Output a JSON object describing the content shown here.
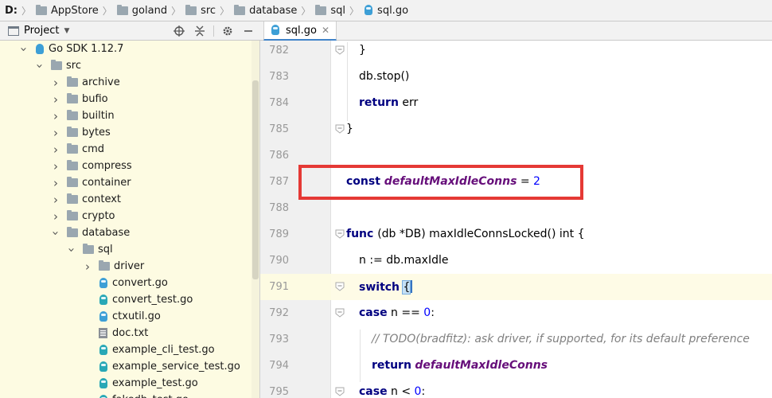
{
  "breadcrumb": {
    "drive": "D:",
    "items": [
      "AppStore",
      "goland",
      "src",
      "database",
      "sql",
      "sql.go"
    ]
  },
  "project_panel": {
    "title": "Project",
    "tools": [
      "locate-icon",
      "collapse-icon",
      "gear-icon",
      "hide-icon"
    ]
  },
  "tree": [
    {
      "label": "Go SDK 1.12.7",
      "icon": "go-sdk-icon",
      "depth": 1,
      "state": "open"
    },
    {
      "label": "src",
      "icon": "folder-icon",
      "depth": 2,
      "state": "open"
    },
    {
      "label": "archive",
      "icon": "folder-icon",
      "depth": 3,
      "state": "closed"
    },
    {
      "label": "bufio",
      "icon": "folder-icon",
      "depth": 3,
      "state": "closed"
    },
    {
      "label": "builtin",
      "icon": "folder-icon",
      "depth": 3,
      "state": "closed"
    },
    {
      "label": "bytes",
      "icon": "folder-icon",
      "depth": 3,
      "state": "closed"
    },
    {
      "label": "cmd",
      "icon": "folder-icon",
      "depth": 3,
      "state": "closed"
    },
    {
      "label": "compress",
      "icon": "folder-icon",
      "depth": 3,
      "state": "closed"
    },
    {
      "label": "container",
      "icon": "folder-icon",
      "depth": 3,
      "state": "closed"
    },
    {
      "label": "context",
      "icon": "folder-icon",
      "depth": 3,
      "state": "closed"
    },
    {
      "label": "crypto",
      "icon": "folder-icon",
      "depth": 3,
      "state": "closed"
    },
    {
      "label": "database",
      "icon": "folder-icon",
      "depth": 3,
      "state": "open"
    },
    {
      "label": "sql",
      "icon": "folder-icon",
      "depth": 4,
      "state": "open"
    },
    {
      "label": "driver",
      "icon": "folder-icon",
      "depth": 5,
      "state": "closed"
    },
    {
      "label": "convert.go",
      "icon": "go-file-icon",
      "depth": 5,
      "state": "none"
    },
    {
      "label": "convert_test.go",
      "icon": "go-test-file-icon",
      "depth": 5,
      "state": "none"
    },
    {
      "label": "ctxutil.go",
      "icon": "go-file-icon",
      "depth": 5,
      "state": "none"
    },
    {
      "label": "doc.txt",
      "icon": "text-file-icon",
      "depth": 5,
      "state": "none"
    },
    {
      "label": "example_cli_test.go",
      "icon": "go-test-file-icon",
      "depth": 5,
      "state": "none"
    },
    {
      "label": "example_service_test.go",
      "icon": "go-test-file-icon",
      "depth": 5,
      "state": "none"
    },
    {
      "label": "example_test.go",
      "icon": "go-test-file-icon",
      "depth": 5,
      "state": "none"
    },
    {
      "label": "fakedb_test.go",
      "icon": "go-test-file-icon",
      "depth": 5,
      "state": "none"
    }
  ],
  "editor_tab": {
    "label": "sql.go",
    "close": "✕"
  },
  "code": {
    "lines": [
      {
        "num": "782",
        "tokens": [
          {
            "t": "}",
            "c": ""
          }
        ],
        "indent": 1
      },
      {
        "num": "783",
        "tokens": [
          {
            "t": "db.stop()",
            "c": ""
          }
        ],
        "indent": 1
      },
      {
        "num": "784",
        "tokens": [
          {
            "t": "return",
            "c": "kw"
          },
          {
            "t": " err",
            "c": ""
          }
        ],
        "indent": 1
      },
      {
        "num": "785",
        "tokens": [
          {
            "t": "}",
            "c": ""
          }
        ],
        "indent": 0
      },
      {
        "num": "786",
        "tokens": [],
        "indent": 0
      },
      {
        "num": "787",
        "tokens": [
          {
            "t": "const ",
            "c": "kw"
          },
          {
            "t": "defaultMaxIdleConns",
            "c": "const"
          },
          {
            "t": " = ",
            "c": ""
          },
          {
            "t": "2",
            "c": "num"
          }
        ],
        "indent": 0
      },
      {
        "num": "788",
        "tokens": [],
        "indent": 0
      },
      {
        "num": "789",
        "tokens": [
          {
            "t": "func ",
            "c": "kw"
          },
          {
            "t": "(db *DB) maxIdleConnsLocked() ",
            "c": ""
          },
          {
            "t": "int",
            "c": ""
          },
          {
            "t": " {",
            "c": ""
          }
        ],
        "indent": 0
      },
      {
        "num": "790",
        "tokens": [
          {
            "t": "n := db.maxIdle",
            "c": ""
          }
        ],
        "indent": 1
      },
      {
        "num": "791",
        "tokens": [
          {
            "t": "switch",
            "c": "kw"
          },
          {
            "t": " ",
            "c": ""
          },
          {
            "t": "{",
            "c": "brace"
          }
        ],
        "indent": 1
      },
      {
        "num": "792",
        "tokens": [
          {
            "t": "case",
            "c": "kw"
          },
          {
            "t": " n == ",
            "c": ""
          },
          {
            "t": "0",
            "c": "num"
          },
          {
            "t": ":",
            "c": ""
          }
        ],
        "indent": 1
      },
      {
        "num": "793",
        "tokens": [
          {
            "t": "// TODO(bradfitz): ask driver, if supported, for its default preference",
            "c": "cm"
          }
        ],
        "indent": 2
      },
      {
        "num": "794",
        "tokens": [
          {
            "t": "return",
            "c": "kw"
          },
          {
            "t": " ",
            "c": ""
          },
          {
            "t": "defaultMaxIdleConns",
            "c": "const"
          }
        ],
        "indent": 2
      },
      {
        "num": "795",
        "tokens": [
          {
            "t": "case",
            "c": "kw"
          },
          {
            "t": " n < ",
            "c": ""
          },
          {
            "t": "0",
            "c": "num"
          },
          {
            "t": ":",
            "c": ""
          }
        ],
        "indent": 1
      }
    ]
  },
  "colors": {
    "keyword": "#000080",
    "constant": "#660e7a",
    "number": "#0000ff",
    "comment": "#808080",
    "highlight_box": "#e53935",
    "tree_bg": "#fdfbe2"
  }
}
